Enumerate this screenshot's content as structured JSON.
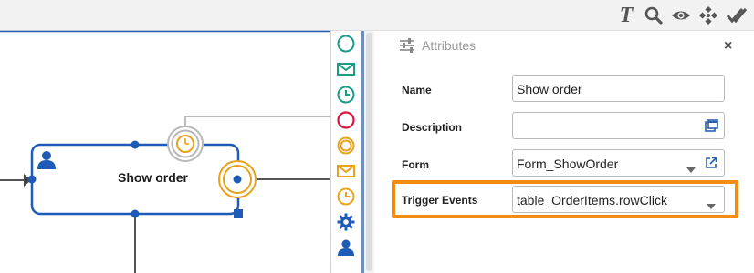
{
  "toolbar": {
    "icons": [
      "text-format-icon",
      "search-icon",
      "eye-icon",
      "move-icon",
      "check-all-icon"
    ],
    "italic_t": "T"
  },
  "diagram": {
    "task": {
      "name": "Show order"
    }
  },
  "palette": {
    "items": [
      {
        "name": "start-event-icon",
        "color": "#1a9c86"
      },
      {
        "name": "message-start-event-icon",
        "color": "#1a9c86"
      },
      {
        "name": "timer-start-event-icon",
        "color": "#1a9c86"
      },
      {
        "name": "end-event-icon",
        "color": "#d9153b"
      },
      {
        "name": "intermediate-event-icon",
        "color": "#e8a21b"
      },
      {
        "name": "message-intermediate-event-icon",
        "color": "#e8a21b"
      },
      {
        "name": "timer-intermediate-event-icon",
        "color": "#e8a21b"
      },
      {
        "name": "service-task-icon",
        "color": "#1e5bb8"
      },
      {
        "name": "user-task-icon",
        "color": "#1e5bb8"
      }
    ]
  },
  "attributes": {
    "title": "Attributes",
    "close": "×",
    "fields": {
      "name": {
        "label": "Name",
        "value": "Show order"
      },
      "description": {
        "label": "Description",
        "value": ""
      },
      "form": {
        "label": "Form",
        "value": "Form_ShowOrder"
      },
      "trigger_events": {
        "label": "Trigger Events",
        "value": "table_OrderItems.rowClick"
      }
    }
  },
  "colors": {
    "accent": "#1e5bb8",
    "highlight": "#f28c12",
    "timer": "#e8a21b"
  }
}
